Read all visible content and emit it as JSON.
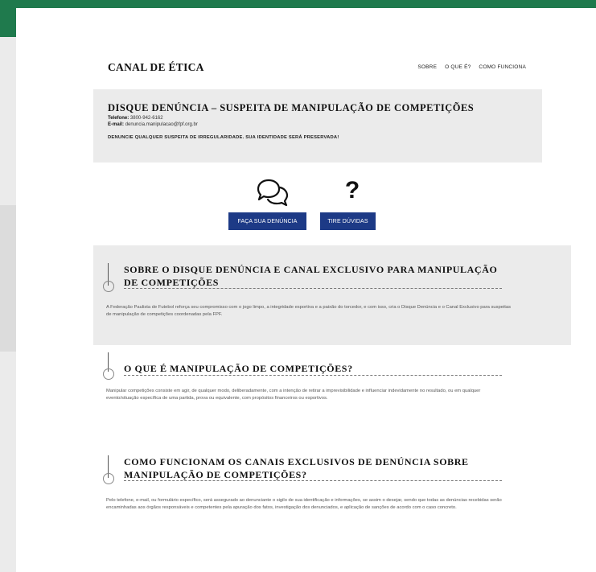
{
  "header": {
    "brand": "CANAL DE ÉTICA",
    "nav": [
      "SOBRE",
      "O QUE É?",
      "COMO FUNCIONA"
    ]
  },
  "hero": {
    "title": "DISQUE DENÚNCIA – SUSPEITA DE MANIPULAÇÃO DE COMPETIÇÕES",
    "phone_label": "Telefone:",
    "phone_value": "3800-942-6162",
    "email_label": "E-mail:",
    "email_value": "denuncia.manipulacao@fpf.org.br",
    "warning": "DENUNCIE QUALQUER SUSPEITA DE IRREGULARIDADE. SUA IDENTIDADE SERÁ PRESERVADA!"
  },
  "icons": {
    "chat": "chat-bubbles-icon",
    "question": "?"
  },
  "buttons": {
    "denuncia": "FAÇA SUA DENÚNCIA",
    "duvidas": "TIRE DÚVIDAS"
  },
  "sections": [
    {
      "title": "SOBRE O DISQUE DENÚNCIA E CANAL EXCLUSIVO PARA MANIPULAÇÃO DE COMPETIÇÕES",
      "text": "A Federação Paulista de Futebol reforça seu compromisso com o jogo limpo, a integridade esportiva e a paixão do torcedor, e com isso, cria o Disque Denúncia e o Canal Exclusivo para suspeitas de manipulação de competições coordenadas pela FPF."
    },
    {
      "title": "O QUE É MANIPULAÇÃO DE COMPETIÇÕES?",
      "text": "Manipular competições consiste em agir, de qualquer modo, deliberadamente, com a intenção de retirar a imprevisibilidade e influenciar indevidamente no resultado, ou em qualquer evento/situação específica de uma partida, prova ou equivalente, com propósitos financeiros ou esportivos."
    },
    {
      "title": "COMO FUNCIONAM OS CANAIS EXCLUSIVOS DE DENÚNCIA SOBRE MANIPULAÇÃO DE COMPETIÇÕES?",
      "text": "Pelo telefone, e-mail, ou formulário específico, será assegurado ao denunciante o sigilo de sua identificação e informações, se assim o desejar, sendo que todas as denúncias recebidas serão encaminhadas aos órgãos responsáveis e competentes pela apuração dos fatos, investigação dos denunciados, e aplicação de sanções de acordo com o caso concreto."
    }
  ],
  "colors": {
    "brand_green": "#1f7a4d",
    "button_blue": "#1d3a86",
    "panel_gray": "#ebebeb"
  }
}
